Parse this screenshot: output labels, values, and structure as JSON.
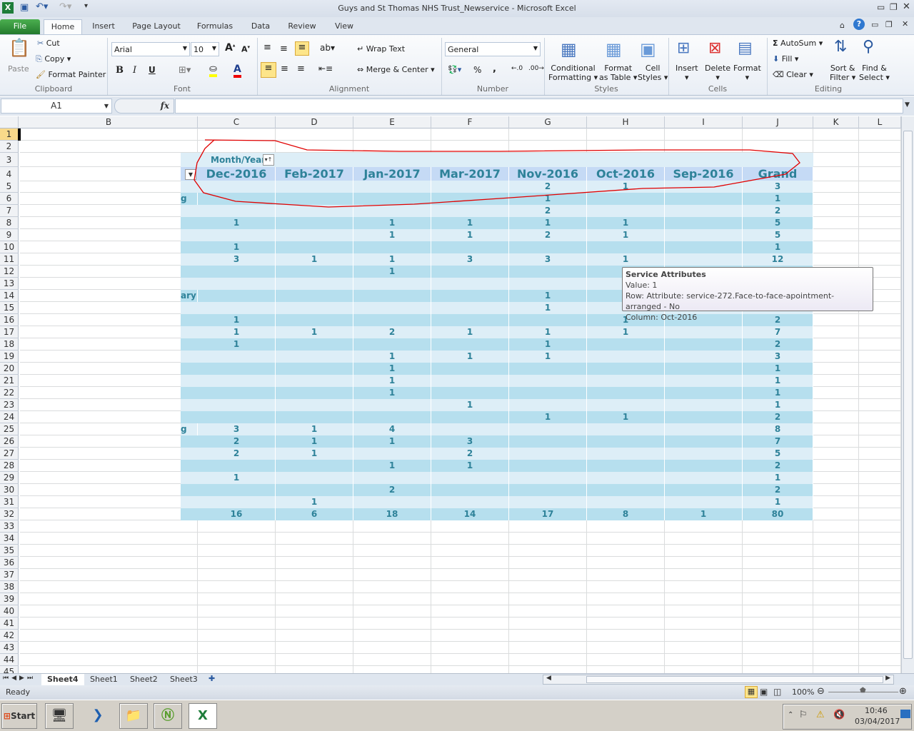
{
  "window": {
    "title": "Guys and St Thomas NHS Trust_Newservice  -  Microsoft Excel"
  },
  "tabs": [
    {
      "label": "File"
    },
    {
      "label": "Home"
    },
    {
      "label": "Insert"
    },
    {
      "label": "Page Layout"
    },
    {
      "label": "Formulas"
    },
    {
      "label": "Data"
    },
    {
      "label": "Review"
    },
    {
      "label": "View"
    }
  ],
  "ribbon": {
    "clipboard": {
      "paste": "Paste",
      "cut": "Cut",
      "copy": "Copy",
      "format_painter": "Format Painter",
      "group": "Clipboard"
    },
    "font": {
      "name": "Arial",
      "size": "10",
      "group": "Font",
      "bold": "B",
      "italic": "I",
      "underline": "U"
    },
    "alignment": {
      "wrap": "Wrap Text",
      "merge": "Merge & Center",
      "group": "Alignment"
    },
    "number": {
      "format": "General",
      "percent": "%",
      "comma": ",",
      "group": "Number"
    },
    "styles": {
      "conditional": "Conditional",
      "conditional2": "Formatting",
      "format_table": "Format",
      "format_table2": "as Table",
      "cell_styles": "Cell",
      "cell_styles2": "Styles",
      "group": "Styles"
    },
    "cells": {
      "insert": "Insert",
      "delete": "Delete",
      "format": "Format",
      "group": "Cells"
    },
    "editing": {
      "autosum": "AutoSum",
      "fill": "Fill",
      "clear": "Clear",
      "sort": "Sort &",
      "sort2": "Filter",
      "find": "Find &",
      "find2": "Select",
      "group": "Editing"
    }
  },
  "formula_bar": {
    "name_box": "A1",
    "fx": "fx",
    "value": ""
  },
  "columns": [
    "B",
    "C",
    "D",
    "E",
    "F",
    "G",
    "H",
    "I",
    "J",
    "K",
    "L"
  ],
  "pivot": {
    "col_field": "Month/Year",
    "headers": [
      "Dec-2016",
      "Feb-2017",
      "Jan-2017",
      "Mar-2017",
      "Nov-2016",
      "Oct-2016",
      "Sep-2016",
      "Grand Total"
    ],
    "rows": [
      {
        "row": 5,
        "label": "",
        "values": [
          "",
          "",
          "",
          "",
          "2",
          "1",
          "",
          "3"
        ]
      },
      {
        "row": 6,
        "label": "g",
        "values": [
          "",
          "",
          "",
          "",
          "1",
          "",
          "",
          "1"
        ]
      },
      {
        "row": 7,
        "label": "",
        "values": [
          "",
          "",
          "",
          "",
          "2",
          "",
          "",
          "2"
        ]
      },
      {
        "row": 8,
        "label": "",
        "values": [
          "1",
          "",
          "1",
          "1",
          "1",
          "1",
          "",
          "5"
        ]
      },
      {
        "row": 9,
        "label": "",
        "values": [
          "",
          "",
          "1",
          "1",
          "2",
          "1",
          "",
          "5"
        ]
      },
      {
        "row": 10,
        "label": "",
        "values": [
          "1",
          "",
          "",
          "",
          "",
          "",
          "",
          "1"
        ]
      },
      {
        "row": 11,
        "label": "",
        "values": [
          "3",
          "1",
          "1",
          "3",
          "3",
          "1",
          "",
          "12"
        ]
      },
      {
        "row": 12,
        "label": "",
        "values": [
          "",
          "",
          "1",
          "",
          "",
          "",
          "",
          ""
        ]
      },
      {
        "row": 13,
        "label": "",
        "values": [
          "",
          "",
          "",
          "",
          "",
          "",
          "",
          ""
        ]
      },
      {
        "row": 14,
        "label": "ary",
        "values": [
          "",
          "",
          "",
          "",
          "1",
          "",
          "",
          ""
        ]
      },
      {
        "row": 15,
        "label": "",
        "values": [
          "",
          "",
          "",
          "",
          "1",
          "",
          "",
          ""
        ]
      },
      {
        "row": 16,
        "label": "",
        "values": [
          "1",
          "",
          "",
          "",
          "",
          "1",
          "",
          "2"
        ]
      },
      {
        "row": 17,
        "label": "",
        "values": [
          "1",
          "1",
          "2",
          "1",
          "1",
          "1",
          "",
          "7"
        ]
      },
      {
        "row": 18,
        "label": "",
        "values": [
          "1",
          "",
          "",
          "",
          "1",
          "",
          "",
          "2"
        ]
      },
      {
        "row": 19,
        "label": "",
        "values": [
          "",
          "",
          "1",
          "1",
          "1",
          "",
          "",
          "3"
        ]
      },
      {
        "row": 20,
        "label": "",
        "values": [
          "",
          "",
          "1",
          "",
          "",
          "",
          "",
          "1"
        ]
      },
      {
        "row": 21,
        "label": "",
        "values": [
          "",
          "",
          "1",
          "",
          "",
          "",
          "",
          "1"
        ]
      },
      {
        "row": 22,
        "label": "",
        "values": [
          "",
          "",
          "1",
          "",
          "",
          "",
          "",
          "1"
        ]
      },
      {
        "row": 23,
        "label": "",
        "values": [
          "",
          "",
          "",
          "1",
          "",
          "",
          "",
          "1"
        ]
      },
      {
        "row": 24,
        "label": "",
        "values": [
          "",
          "",
          "",
          "",
          "1",
          "1",
          "",
          "2"
        ]
      },
      {
        "row": 25,
        "label": "g",
        "values": [
          "3",
          "1",
          "4",
          "",
          "",
          "",
          "",
          "8"
        ]
      },
      {
        "row": 26,
        "label": "",
        "values": [
          "2",
          "1",
          "1",
          "3",
          "",
          "",
          "",
          "7"
        ]
      },
      {
        "row": 27,
        "label": "",
        "values": [
          "2",
          "1",
          "",
          "2",
          "",
          "",
          "",
          "5"
        ]
      },
      {
        "row": 28,
        "label": "",
        "values": [
          "",
          "",
          "1",
          "1",
          "",
          "",
          "",
          "2"
        ]
      },
      {
        "row": 29,
        "label": "",
        "values": [
          "1",
          "",
          "",
          "",
          "",
          "",
          "",
          "1"
        ]
      },
      {
        "row": 30,
        "label": "",
        "values": [
          "",
          "",
          "2",
          "",
          "",
          "",
          "",
          "2"
        ]
      },
      {
        "row": 31,
        "label": "",
        "values": [
          "",
          "1",
          "",
          "",
          "",
          "",
          "",
          "1"
        ]
      },
      {
        "row": 32,
        "label": "",
        "values": [
          "16",
          "6",
          "18",
          "14",
          "17",
          "8",
          "1",
          "80"
        ]
      }
    ]
  },
  "tooltip": {
    "title": "Service Attributes",
    "value": "Value: 1",
    "row": "Row: Attribute: service-272.Face-to-face-apointment-arranged - No",
    "column": "Column: Oct-2016"
  },
  "sheets": [
    {
      "label": "Sheet4",
      "active": true
    },
    {
      "label": "Sheet1"
    },
    {
      "label": "Sheet2"
    },
    {
      "label": "Sheet3"
    }
  ],
  "status": {
    "ready": "Ready",
    "zoom": "100%",
    "zoom_level": 100
  },
  "taskbar": {
    "start": "Start",
    "time": "10:46",
    "date": "03/04/2017"
  },
  "colors": {
    "pivot_text": "#2e8299",
    "band_light": "#ddeef7",
    "band_dark": "#b6dfee",
    "header": "#c5daf5",
    "annotation": "#e00000"
  }
}
